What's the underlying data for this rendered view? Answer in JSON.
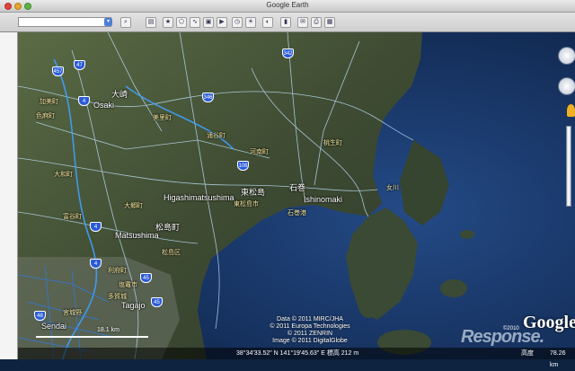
{
  "window": {
    "title": "Google Earth"
  },
  "toolbar": {
    "search_value": ""
  },
  "map": {
    "places": {
      "osaki_jp": "大崎",
      "osaki": "Osaki",
      "higashimatsushima": "Higashimatsushima",
      "higashimatsushima_jp": "東松島",
      "ishinomaki_jp": "石巻",
      "ishinomaki": "Ishinomaki",
      "matsushima_jp": "松島町",
      "matsushima": "Matsushima",
      "sendai": "Sendai",
      "tagajo": "Tagajo",
      "miyagino_jp": "宮城野",
      "onagawa_jp": "女川",
      "tagajo_jp": "多賀城",
      "misato_jp": "美里町",
      "shikama_jp": "色麻町",
      "kami_jp": "加美町",
      "osato_jp": "大郷町",
      "tomiya_jp": "富谷町",
      "rifu_jp": "利府町",
      "taiwa_jp": "大和町",
      "wakuya_jp": "涌谷町",
      "kanan_jp": "河南町",
      "kamigawa_jp": "桃生町",
      "ishinomaki_road_jp": "石巻港",
      "matsushima_ku_jp": "松島区",
      "shiogama_jp": "塩竈市",
      "toms_jp": "東松島市"
    },
    "routes": [
      "457",
      "47",
      "346",
      "4",
      "342",
      "108",
      "45",
      "4",
      "4",
      "48",
      "45"
    ],
    "credits": [
      "Data © 2011 MIRC/JHA",
      "© 2011 Europa Technologies",
      "© 2011 ZENRIN",
      "Image © 2011 DigitalGlobe"
    ],
    "scale_label": "18.1 km",
    "copyright_small": "©2010",
    "logo_text": "Google",
    "watermark": "Response."
  },
  "status": {
    "coords": "38°34'33.52\" N 141°19'45.63\" E 標高  212 m",
    "alt_label": "高度",
    "alt_value": "78.26 km"
  }
}
